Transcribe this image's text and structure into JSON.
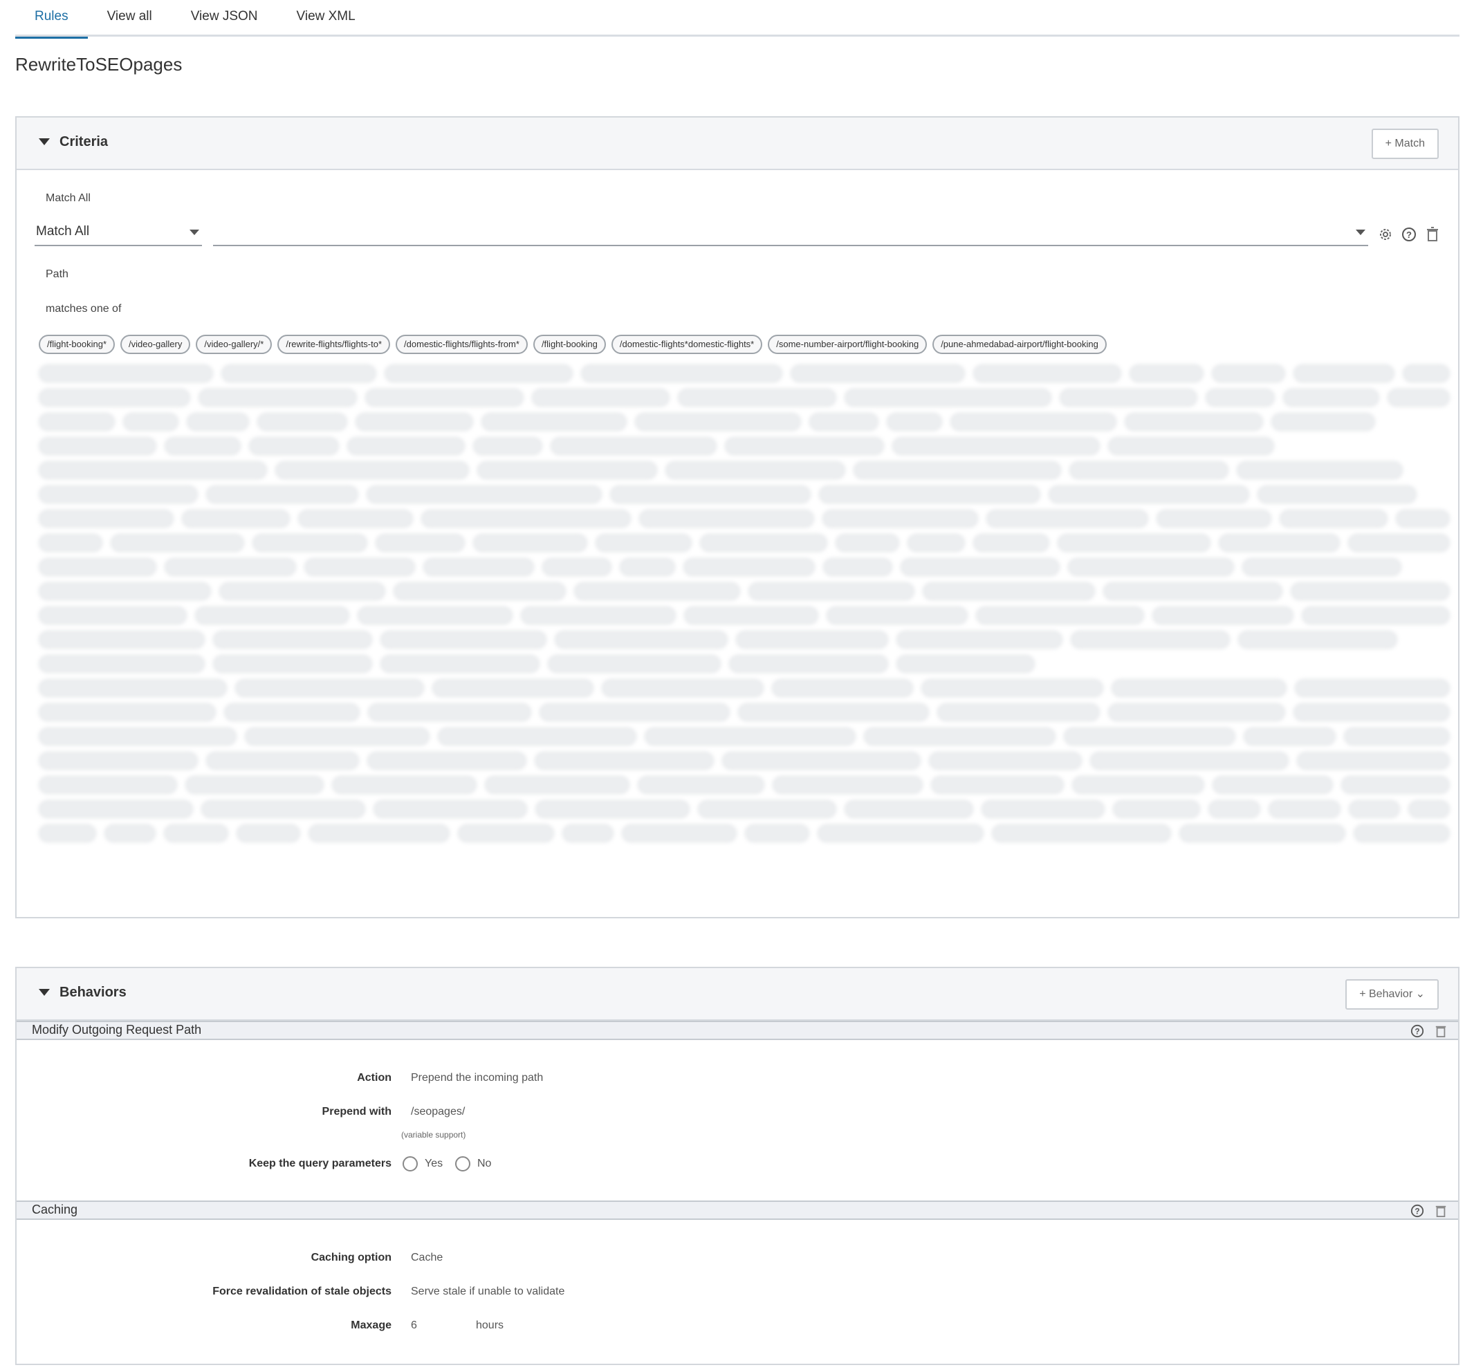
{
  "tabs": [
    {
      "label": "Rules",
      "active": true
    },
    {
      "label": "View all",
      "active": false
    },
    {
      "label": "View JSON",
      "active": false
    },
    {
      "label": "View XML",
      "active": false
    }
  ],
  "rule": {
    "name": "RewriteToSEOpages"
  },
  "criteria": {
    "title": "Criteria",
    "add_button": "+ Match",
    "match_label": "Match All",
    "match_select": "Match All",
    "path_label": "Path",
    "operator_label": "matches one of",
    "chips": [
      "/flight-booking*",
      "/video-gallery",
      "/video-gallery/*",
      "/rewrite-flights/flights-to*",
      "/domestic-flights/flights-from*",
      "/flight-booking",
      "/domestic-flights*domestic-flights*",
      "/some-number-airport/flight-booking",
      "/pune-ahmedabad-airport/flight-booking"
    ]
  },
  "behaviors": {
    "title": "Behaviors",
    "add_button": "+ Behavior",
    "modify_path": {
      "title": "Modify Outgoing Request Path",
      "action_label": "Action",
      "action_value": "Prepend the incoming path",
      "prepend_label": "Prepend with",
      "prepend_value": "/seopages/",
      "prepend_note": "(variable support)",
      "query_label": "Keep the query parameters",
      "yes_label": "Yes",
      "no_label": "No"
    },
    "caching": {
      "title": "Caching",
      "option_label": "Caching option",
      "option_value": "Cache",
      "revalidation_label": "Force revalidation of stale objects",
      "revalidation_value": "Serve stale if unable to validate",
      "maxage_label": "Maxage",
      "maxage_value": "6",
      "maxage_unit": "hours"
    }
  }
}
